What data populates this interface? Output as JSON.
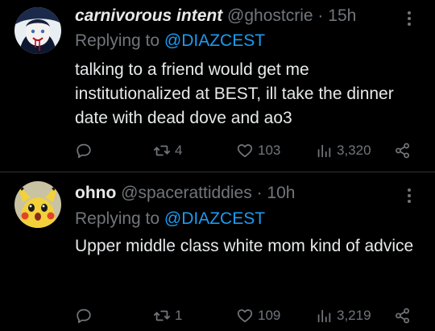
{
  "tweets": [
    {
      "name": "carnivorous intent",
      "handle": "@ghostcrie",
      "separator": "·",
      "time": "15h",
      "replying_prefix": "Replying to",
      "replying_to": "@DIAZCEST",
      "text": "talking to a friend would get me institutionalized at BEST, ill take the dinner date with dead dove and ao3",
      "retweets": "4",
      "likes": "103",
      "views": "3,320"
    },
    {
      "name": "ohno",
      "handle": "@spacerattiddies",
      "separator": "·",
      "time": "10h",
      "replying_prefix": "Replying to",
      "replying_to": "@DIAZCEST",
      "text": "Upper middle class white mom kind of advice",
      "retweets": "1",
      "likes": "109",
      "views": "3,219"
    }
  ],
  "icons": {
    "reply": "reply-icon",
    "retweet": "retweet-icon",
    "like": "heart-icon",
    "views": "views-chart-icon",
    "share": "share-icon",
    "more": "more-dots-icon"
  },
  "colors": {
    "background": "#000000",
    "text": "#e7e9ea",
    "muted": "#71767b",
    "link": "#1d9bf0",
    "divider": "#2f3336"
  }
}
